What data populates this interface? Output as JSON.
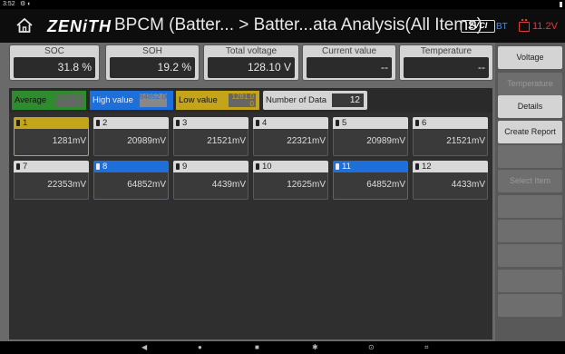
{
  "statusbar": {
    "time": "3:52",
    "icons": "⚙ ◐"
  },
  "header": {
    "logo": "ZENiTH",
    "title": "BPCM (Batter... > Batter...ata Analysis(All Items)",
    "zvci": "ZVCI",
    "bt": "BT",
    "battery_voltage": "11.2V"
  },
  "metrics": [
    {
      "label": "SOC",
      "value": "31.8 %"
    },
    {
      "label": "SOH",
      "value": "19.2 %"
    },
    {
      "label": "Total voltage",
      "value": "128.10 V"
    },
    {
      "label": "Current value",
      "value": "--"
    },
    {
      "label": "Temperature",
      "value": "--"
    }
  ],
  "filters": {
    "average": {
      "label": "Average",
      "value": "23514.6 7"
    },
    "high": {
      "label": "High value",
      "value": "64852.00"
    },
    "low": {
      "label": "Low value",
      "value": "1281.0 0"
    },
    "count": {
      "label": "Number of Data",
      "value": "12"
    }
  },
  "cells": [
    {
      "id": "1",
      "value": "1281mV",
      "state": "low"
    },
    {
      "id": "2",
      "value": "20989mV",
      "state": "normal"
    },
    {
      "id": "3",
      "value": "21521mV",
      "state": "normal"
    },
    {
      "id": "4",
      "value": "22321mV",
      "state": "normal"
    },
    {
      "id": "5",
      "value": "20989mV",
      "state": "normal"
    },
    {
      "id": "6",
      "value": "21521mV",
      "state": "normal"
    },
    {
      "id": "7",
      "value": "22353mV",
      "state": "normal"
    },
    {
      "id": "8",
      "value": "64852mV",
      "state": "high"
    },
    {
      "id": "9",
      "value": "4439mV",
      "state": "normal"
    },
    {
      "id": "10",
      "value": "12625mV",
      "state": "normal"
    },
    {
      "id": "11",
      "value": "64852mV",
      "state": "high"
    },
    {
      "id": "12",
      "value": "4433mV",
      "state": "normal"
    }
  ],
  "side_buttons": [
    {
      "label": "Voltage",
      "state": "active"
    },
    {
      "label": "Temperature",
      "state": "disabled"
    },
    {
      "label": "Details",
      "state": "active"
    },
    {
      "label": "Create Report",
      "state": "active"
    },
    {
      "label": "",
      "state": "empty"
    },
    {
      "label": "Select Item",
      "state": "disabled"
    },
    {
      "label": "",
      "state": "empty"
    },
    {
      "label": "",
      "state": "empty"
    },
    {
      "label": "",
      "state": "empty"
    },
    {
      "label": "",
      "state": "empty"
    },
    {
      "label": "",
      "state": "empty"
    }
  ],
  "navbar": {
    "back": "◀",
    "home": "●",
    "recent": "■",
    "settings": "✱",
    "vci": "⊙",
    "screenshot": "⌗"
  },
  "colors": {
    "average": "#2e8b2e",
    "high": "#1e6fd9",
    "low": "#c4a51a",
    "battery_warning": "#e03a3a"
  }
}
